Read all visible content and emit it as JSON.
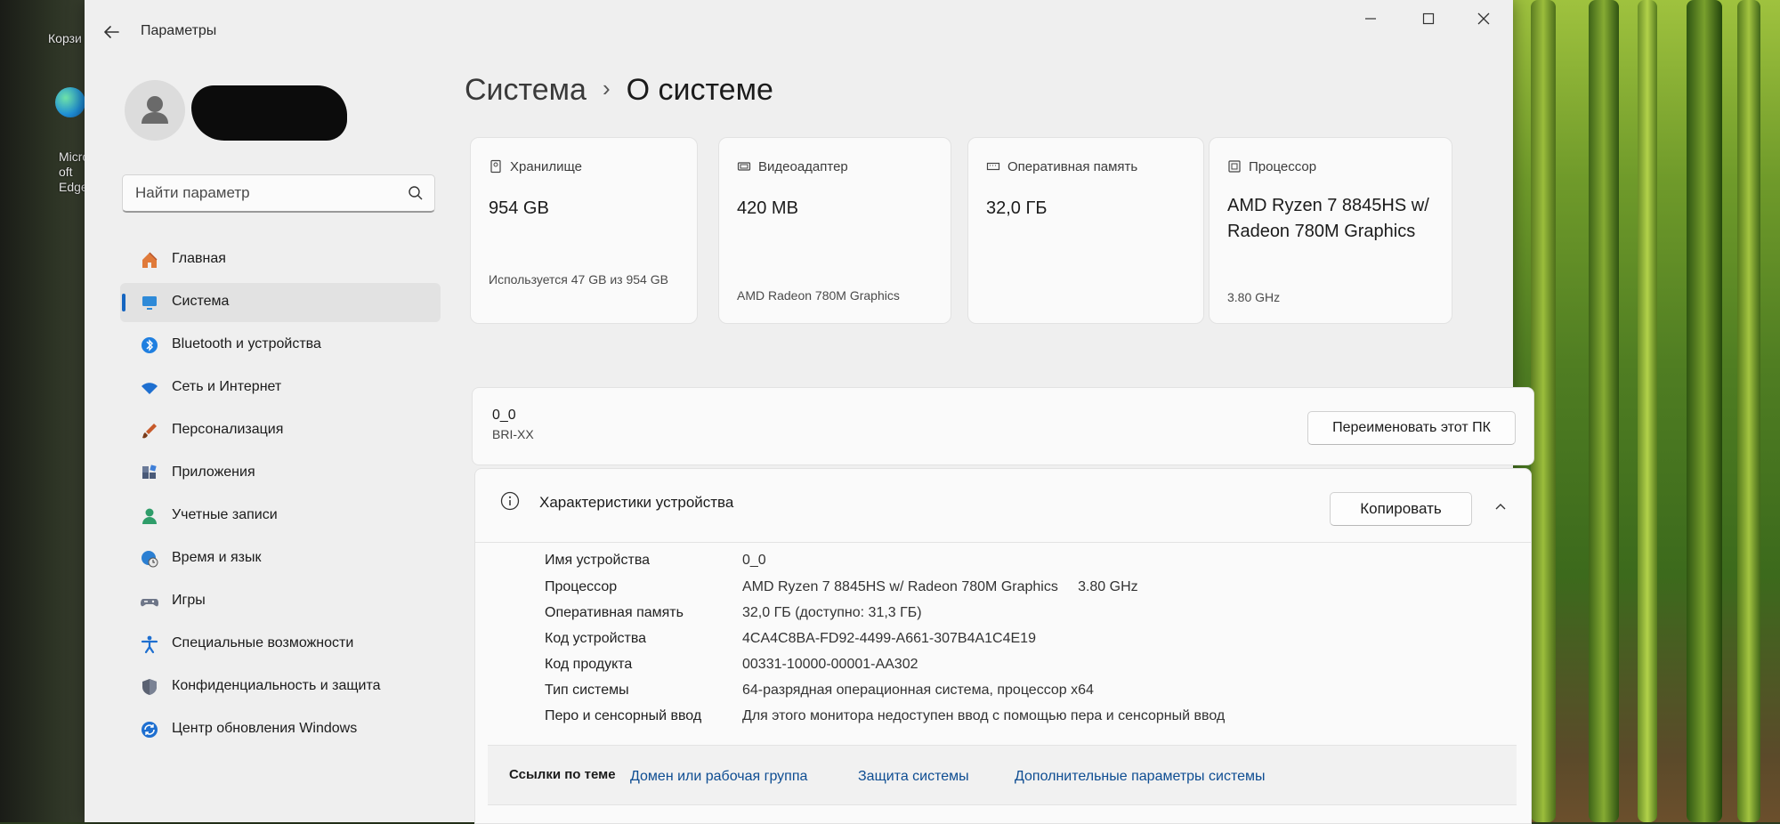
{
  "window": {
    "title": "Параметры",
    "back_icon": "back-arrow-icon"
  },
  "desktop": {
    "recycle_label": "Корзи",
    "edge_label": "Micros oft Edge"
  },
  "account": {
    "name": "",
    "email": ""
  },
  "search": {
    "placeholder": "Найти параметр"
  },
  "breadcrumb": {
    "parent": "Система",
    "current": "О системе"
  },
  "sidebar": {
    "items": [
      {
        "label": "Главная",
        "icon": "home-icon",
        "active": false
      },
      {
        "label": "Система",
        "icon": "display-icon",
        "active": true
      },
      {
        "label": "Bluetooth и устройства",
        "icon": "bluetooth-icon",
        "active": false
      },
      {
        "label": "Сеть и Интернет",
        "icon": "wifi-icon",
        "active": false
      },
      {
        "label": "Персонализация",
        "icon": "brush-icon",
        "active": false
      },
      {
        "label": "Приложения",
        "icon": "apps-icon",
        "active": false
      },
      {
        "label": "Учетные записи",
        "icon": "person-icon",
        "active": false
      },
      {
        "label": "Время и язык",
        "icon": "globe-clock-icon",
        "active": false
      },
      {
        "label": "Игры",
        "icon": "gamepad-icon",
        "active": false
      },
      {
        "label": "Специальные возможности",
        "icon": "accessibility-icon",
        "active": false
      },
      {
        "label": "Конфиденциальность и защита",
        "icon": "shield-icon",
        "active": false
      },
      {
        "label": "Центр обновления Windows",
        "icon": "update-icon",
        "active": false
      }
    ]
  },
  "cards": [
    {
      "label": "Хранилище",
      "value": "954 GB",
      "sub": "Используется 47 GB из 954 GB",
      "icon": "storage-icon"
    },
    {
      "label": "Видеоадаптер",
      "value": "420 MB",
      "sub": "AMD Radeon 780M Graphics",
      "icon": "gpu-icon"
    },
    {
      "label": "Оперативная память",
      "value": "32,0 ГБ",
      "sub": "",
      "icon": "ram-icon"
    },
    {
      "label": "Процессор",
      "value": "AMD Ryzen 7 8845HS w/ Radeon 780M Graphics",
      "sub": "3.80 GHz",
      "icon": "cpu-icon"
    }
  ],
  "rename": {
    "pc_name": "0_0",
    "model": "BRI-XX",
    "button": "Переименовать этот ПК"
  },
  "specs": {
    "title": "Характеристики устройства",
    "copy_button": "Копировать",
    "rows": [
      {
        "label": "Имя устройства",
        "value": "0_0"
      },
      {
        "label": "Процессор",
        "value": "AMD Ryzen 7 8845HS w/ Radeon 780M Graphics     3.80 GHz"
      },
      {
        "label": "Оперативная память",
        "value": "32,0 ГБ (доступно: 31,3 ГБ)"
      },
      {
        "label": "Код устройства",
        "value": "4CA4C8BA-FD92-4499-A661-307B4A1C4E19"
      },
      {
        "label": "Код продукта",
        "value": "00331-10000-00001-AA302"
      },
      {
        "label": "Тип системы",
        "value": "64-разрядная операционная система, процессор x64"
      },
      {
        "label": "Перо и сенсорный ввод",
        "value": "Для этого монитора недоступен ввод с помощью пера и сенсорный ввод"
      }
    ]
  },
  "related": {
    "label": "Ссылки по теме",
    "links": [
      "Домен или рабочая группа",
      "Защита системы",
      "Дополнительные параметры системы"
    ]
  },
  "colors": {
    "accent": "#1565c0",
    "link": "#0e4d92",
    "window_bg": "#efefef",
    "card_bg": "#fafafa"
  }
}
